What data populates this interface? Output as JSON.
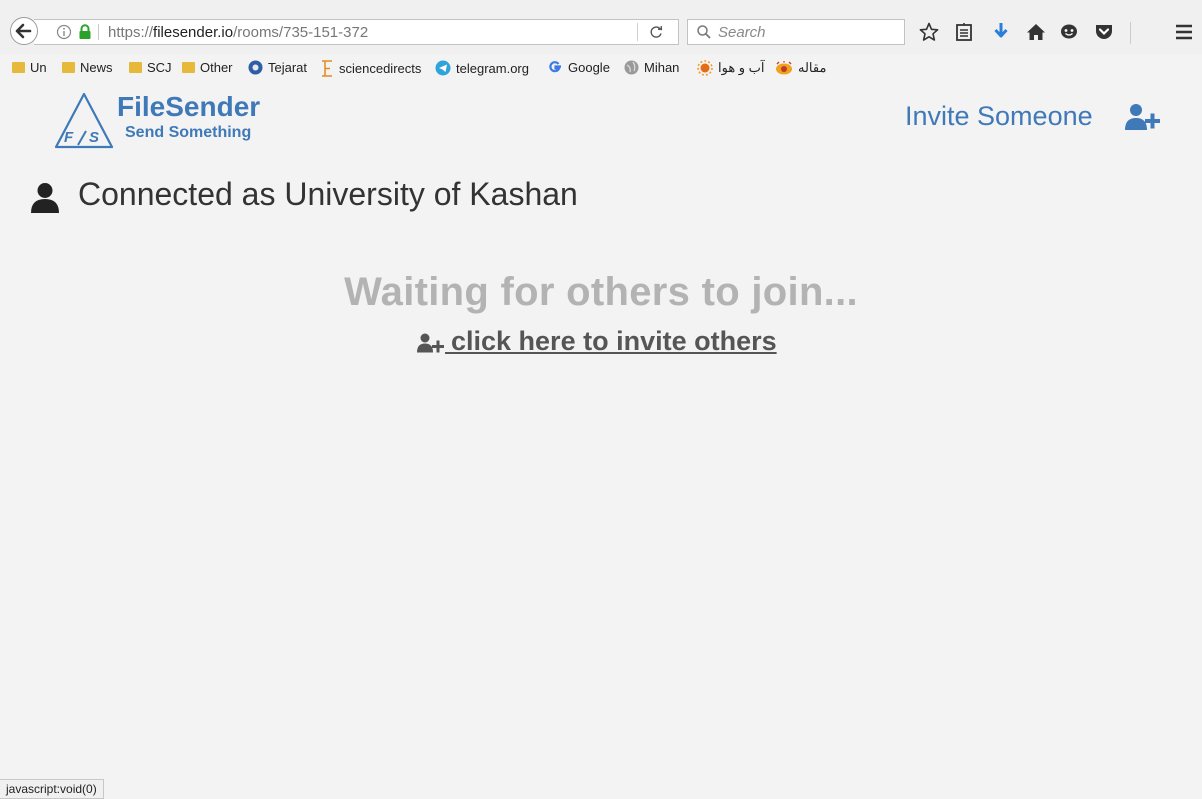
{
  "browser": {
    "url_scheme": "https://",
    "url_host": "filesender.io",
    "url_path": "/rooms/735-151-372",
    "search_placeholder": "Search",
    "status_text": "javascript:void(0)",
    "bookmarks": [
      {
        "label": "Un",
        "icon": "folder-icon"
      },
      {
        "label": "News",
        "icon": "folder-icon"
      },
      {
        "label": "SCJ",
        "icon": "folder-icon"
      },
      {
        "label": "Other",
        "icon": "folder-icon"
      },
      {
        "label": "Tejarat",
        "icon": "tejarat-icon"
      },
      {
        "label": "sciencedirects",
        "icon": "elsevier-icon"
      },
      {
        "label": "telegram.org",
        "icon": "telegram-icon"
      },
      {
        "label": "Google",
        "icon": "google-icon"
      },
      {
        "label": "Mihan",
        "icon": "globe-icon"
      },
      {
        "label": "آب و هوا",
        "icon": "sun-icon"
      },
      {
        "label": "مقاله",
        "icon": "eye-icon"
      }
    ]
  },
  "header": {
    "logo_title": "FileSender",
    "logo_subtitle": "Send Something",
    "logo_mark": "F/\\S",
    "invite_label": "Invite Someone"
  },
  "main": {
    "connected_text": "Connected as University of Kashan",
    "waiting_text": "Waiting for others to join...",
    "invite_link": "click here to invite others"
  },
  "colors": {
    "brand": "#3f79b8",
    "waiting": "#b3b3b3",
    "link": "#555555"
  }
}
